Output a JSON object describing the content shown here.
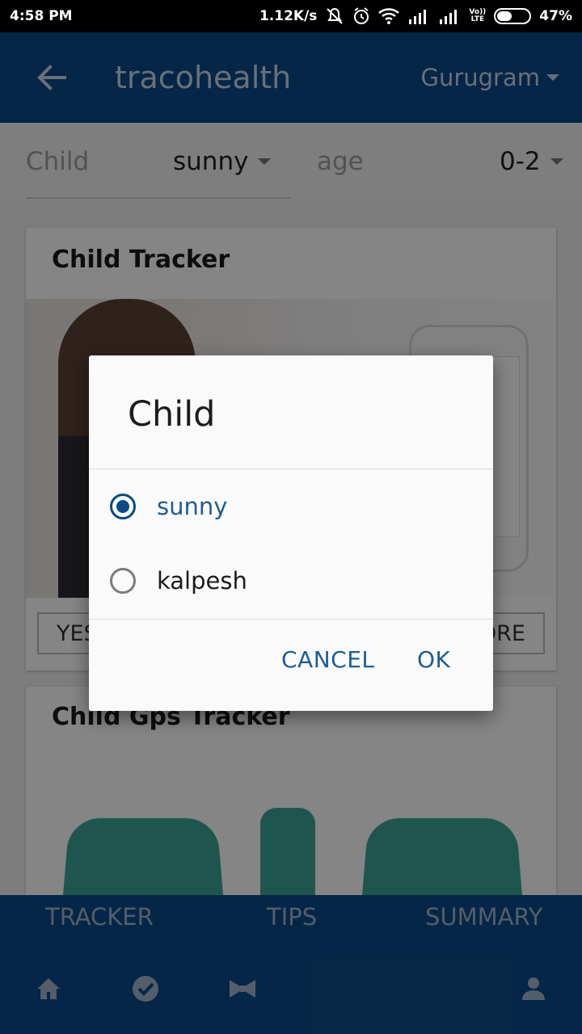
{
  "status_bar": {
    "time": "4:58 PM",
    "network_speed": "1.12K/s",
    "lte_top": "Vo))",
    "lte_bottom": "LTE",
    "battery": "47%",
    "battery_level": 0.47,
    "icons": [
      "mute-icon",
      "alarm-icon",
      "wifi-icon",
      "signal-icon",
      "signal-icon",
      "battery-icon"
    ]
  },
  "app_bar": {
    "title": "tracohealth",
    "city": "Gurugram",
    "back_icon": "arrow-left-icon"
  },
  "filters": {
    "child_label": "Child",
    "child_value": "sunny",
    "age_label": "age",
    "age_value": "0-2"
  },
  "cards": [
    {
      "title": "Child Tracker",
      "left_button": "YES",
      "right_button": "MORE"
    },
    {
      "title": "Child Gps Tracker"
    }
  ],
  "bottom_tabs": [
    "TRACKER",
    "TIPS",
    "SUMMARY"
  ],
  "bottom_nav_icons": [
    "home-icon",
    "check-circle-icon",
    "bowtie-icon",
    "person-icon"
  ],
  "dialog": {
    "title": "Child",
    "options": [
      {
        "label": "sunny",
        "selected": true
      },
      {
        "label": "kalpesh",
        "selected": false
      }
    ],
    "cancel_label": "CANCEL",
    "ok_label": "OK"
  },
  "colors": {
    "primary": "#0b4a86",
    "accent": "#1f5d92",
    "scrim": "#000000"
  }
}
